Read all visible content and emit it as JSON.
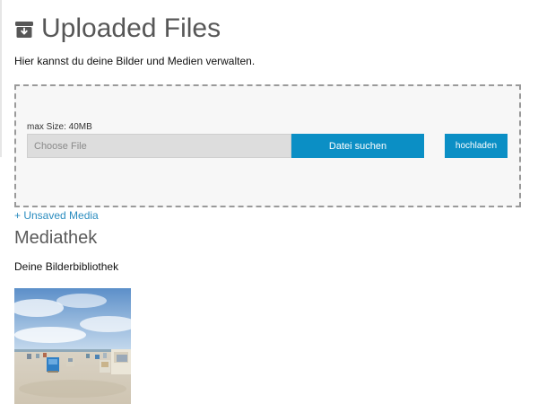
{
  "page": {
    "title": "Uploaded Files",
    "subtitle": "Hier kannst du deine Bilder und Medien verwalten."
  },
  "upload": {
    "max_size_label": "max Size: 40MB",
    "file_placeholder": "Choose File",
    "browse_label": "Datei suchen",
    "upload_label": "hochladen"
  },
  "unsaved_media_link": "+ Unsaved Media",
  "library": {
    "title": "Mediathek",
    "subtitle": "Deine Bilderbibliothek",
    "items": [
      {
        "kind": "image",
        "subject": "beach with blue beach chairs"
      }
    ]
  },
  "colors": {
    "accent": "#0b8fc5",
    "link": "#2a8cbf",
    "title_gray": "#575757",
    "dropzone_border": "#9a9a9a",
    "dropzone_bg": "#f7f7f7"
  },
  "icons": {
    "title_icon": "archive-download-icon"
  }
}
